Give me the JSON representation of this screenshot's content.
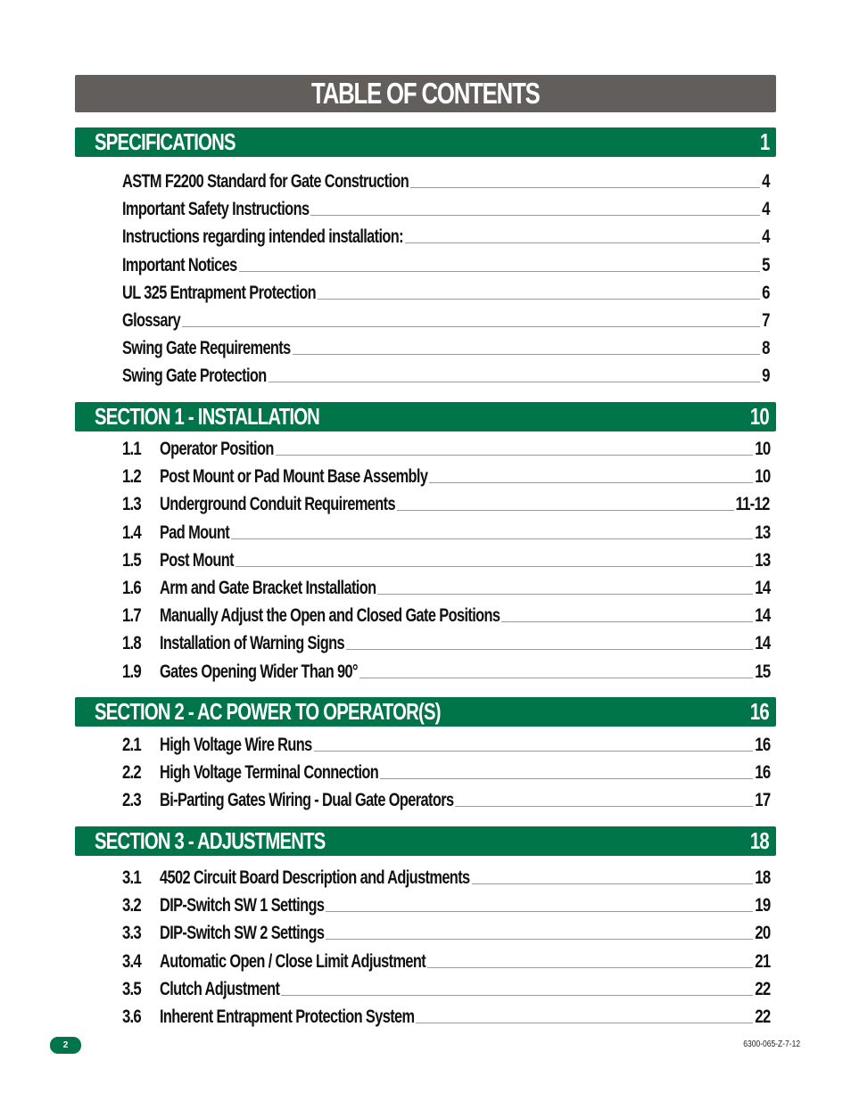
{
  "title": "TABLE OF CONTENTS",
  "sections": [
    {
      "label": "SPECIFICATIONS",
      "page": "1",
      "entries": [
        {
          "num": "",
          "text": "ASTM F2200 Standard for Gate Construction",
          "page": "4"
        },
        {
          "num": "",
          "text": "Important Safety Instructions",
          "page": "4"
        },
        {
          "num": "",
          "text": "Instructions regarding intended installation:",
          "page": "4"
        },
        {
          "num": "",
          "text": "Important Notices",
          "page": "5"
        },
        {
          "num": "",
          "text": "UL 325 Entrapment Protection",
          "page": "6"
        },
        {
          "num": "",
          "text": "Glossary",
          "page": "7"
        },
        {
          "num": "",
          "text": "Swing Gate Requirements",
          "page": "8"
        },
        {
          "num": "",
          "text": "Swing Gate Protection",
          "page": "9"
        }
      ]
    },
    {
      "label": "SECTION 1 - INSTALLATION",
      "page": "10",
      "entries": [
        {
          "num": "1.1",
          "text": "Operator Position",
          "page": "10"
        },
        {
          "num": "1.2",
          "text": "Post Mount or Pad Mount Base Assembly",
          "page": "10"
        },
        {
          "num": "1.3",
          "text": "Underground Conduit Requirements",
          "page": "11-12"
        },
        {
          "num": "1.4",
          "text": "Pad Mount",
          "page": "13"
        },
        {
          "num": "1.5",
          "text": "Post Mount",
          "page": "13"
        },
        {
          "num": "1.6",
          "text": "Arm and Gate Bracket Installation",
          "page": "14"
        },
        {
          "num": "1.7",
          "text": "Manually Adjust the Open and Closed Gate Positions",
          "page": "14"
        },
        {
          "num": "1.8",
          "text": "Installation of Warning Signs",
          "page": "14"
        },
        {
          "num": "1.9",
          "text": "Gates Opening Wider Than 90°",
          "page": "15"
        }
      ]
    },
    {
      "label": "SECTION 2 - AC POWER TO OPERATOR(S)",
      "page": "16",
      "entries": [
        {
          "num": "2.1",
          "text": "High Voltage Wire Runs",
          "page": "16"
        },
        {
          "num": "2.2",
          "text": "High Voltage Terminal Connection",
          "page": "16"
        },
        {
          "num": "2.3",
          "text": "Bi-Parting Gates Wiring - Dual Gate Operators",
          "page": "17"
        }
      ]
    },
    {
      "label": "SECTION 3 - ADJUSTMENTS",
      "page": "18",
      "entries": [
        {
          "num": "3.1",
          "text": "4502 Circuit Board Description and Adjustments",
          "page": "18"
        },
        {
          "num": "3.2",
          "text": "DIP-Switch SW 1 Settings",
          "page": "19"
        },
        {
          "num": "3.3",
          "text": "DIP-Switch SW 2 Settings",
          "page": "20"
        },
        {
          "num": "3.4",
          "text": "Automatic Open / Close Limit Adjustment",
          "page": "21"
        },
        {
          "num": "3.5",
          "text": "Clutch Adjustment",
          "page": "22"
        },
        {
          "num": "3.6",
          "text": "Inherent Entrapment Protection System",
          "page": "22"
        }
      ]
    }
  ],
  "footer": {
    "page_number": "2",
    "doc_code": "6300-065-Z-7-12"
  },
  "colors": {
    "title_bar": "#625e5c",
    "section_bar": "#00754a"
  }
}
